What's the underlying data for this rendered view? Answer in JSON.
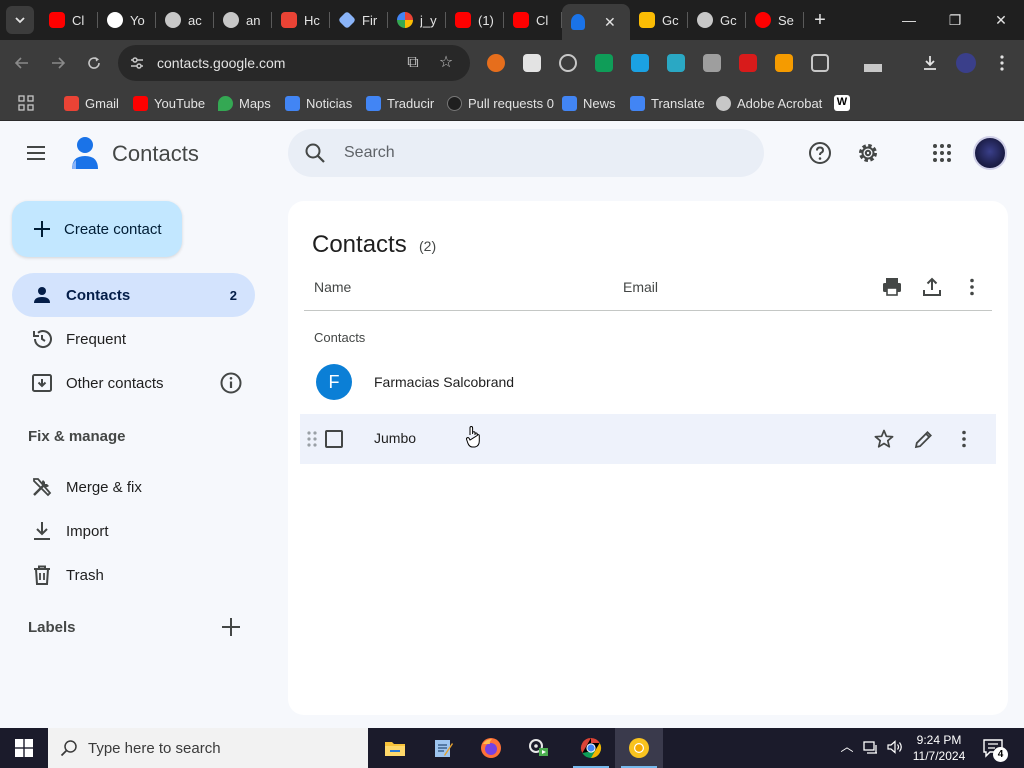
{
  "browser": {
    "tabs": [
      {
        "label": "Cl",
        "favicon": "youtube-icon",
        "color": "#ff0000"
      },
      {
        "label": "Yo",
        "favicon": "google-icon",
        "color": "#ffffff"
      },
      {
        "label": "ac",
        "favicon": "globe-icon",
        "color": "#c7c7c7"
      },
      {
        "label": "an",
        "favicon": "globe-icon",
        "color": "#c7c7c7"
      },
      {
        "label": "Hc",
        "favicon": "gmail-icon",
        "color": "#ea4335"
      },
      {
        "label": "Fir",
        "favicon": "tag-icon",
        "color": "#c7c7c7"
      },
      {
        "label": "j_y",
        "favicon": "pinwheel-icon",
        "color": "#fbbc04"
      },
      {
        "label": "(1)",
        "favicon": "youtube-icon",
        "color": "#ff0000"
      },
      {
        "label": "Cl",
        "favicon": "youtube-icon",
        "color": "#ff0000"
      },
      {
        "label": "",
        "favicon": "contacts-icon",
        "color": "#1a73e8",
        "active": true
      },
      {
        "label": "Gc",
        "favicon": "keep-icon",
        "color": "#fbbc04"
      },
      {
        "label": "Gc",
        "favicon": "globe-icon",
        "color": "#c7c7c7"
      },
      {
        "label": "Se",
        "favicon": "youtube-icon",
        "color": "#ff0000"
      }
    ],
    "new_tab": "+",
    "window_controls": {
      "minimize": "—",
      "maximize": "❐",
      "close": "✕"
    },
    "url": "contacts.google.com",
    "bookmarks": [
      {
        "label": "Gmail",
        "favicon": "gmail-icon",
        "color": "#ea4335"
      },
      {
        "label": "YouTube",
        "favicon": "youtube-icon",
        "color": "#ff0000"
      },
      {
        "label": "Maps",
        "favicon": "maps-icon",
        "color": "#34a853"
      },
      {
        "label": "Noticias",
        "favicon": "news-icon",
        "color": "#4285f4"
      },
      {
        "label": "Traducir",
        "favicon": "translate-icon",
        "color": "#4285f4"
      },
      {
        "label": "Pull requests 0",
        "favicon": "github-icon",
        "color": "#1f1f1f"
      },
      {
        "label": "News",
        "favicon": "news-icon",
        "color": "#4285f4"
      },
      {
        "label": "Translate",
        "favicon": "translate-icon",
        "color": "#4285f4"
      },
      {
        "label": "Adobe Acrobat",
        "favicon": "globe-icon",
        "color": "#c7c7c7"
      },
      {
        "label": "",
        "favicon": "wikipedia-icon",
        "color": "#ffffff"
      }
    ]
  },
  "app": {
    "title": "Contacts",
    "search_placeholder": "Search",
    "create_label": "Create contact",
    "nav": [
      {
        "label": "Contacts",
        "count": "2",
        "icon": "person-icon",
        "active": true
      },
      {
        "label": "Frequent",
        "icon": "history-icon"
      },
      {
        "label": "Other contacts",
        "icon": "inbox-download-icon"
      }
    ],
    "fix_manage_heading": "Fix & manage",
    "fix_nav": [
      {
        "label": "Merge & fix",
        "icon": "tools-icon"
      },
      {
        "label": "Import",
        "icon": "download-icon"
      },
      {
        "label": "Trash",
        "icon": "trash-icon"
      }
    ],
    "labels_heading": "Labels",
    "list": {
      "title": "Contacts",
      "count": "(2)",
      "columns": {
        "name": "Name",
        "email": "Email"
      },
      "group_label": "Contacts",
      "rows": [
        {
          "name": "Farmacias Salcobrand",
          "initial": "F",
          "avatar_color": "#0b7fd6"
        },
        {
          "name": "Jumbo",
          "hovered": true
        }
      ]
    },
    "accent_color": "#c2e7ff",
    "active_nav_color": "#d3e3fd"
  },
  "taskbar": {
    "search_placeholder": "Type here to search",
    "time": "9:24 PM",
    "date": "11/7/2024",
    "notification_count": "4",
    "apps": [
      "file-explorer-icon",
      "notepad-icon",
      "firefox-icon",
      "video-editor-icon",
      "chrome-icon",
      "chrome-canary-icon"
    ]
  }
}
